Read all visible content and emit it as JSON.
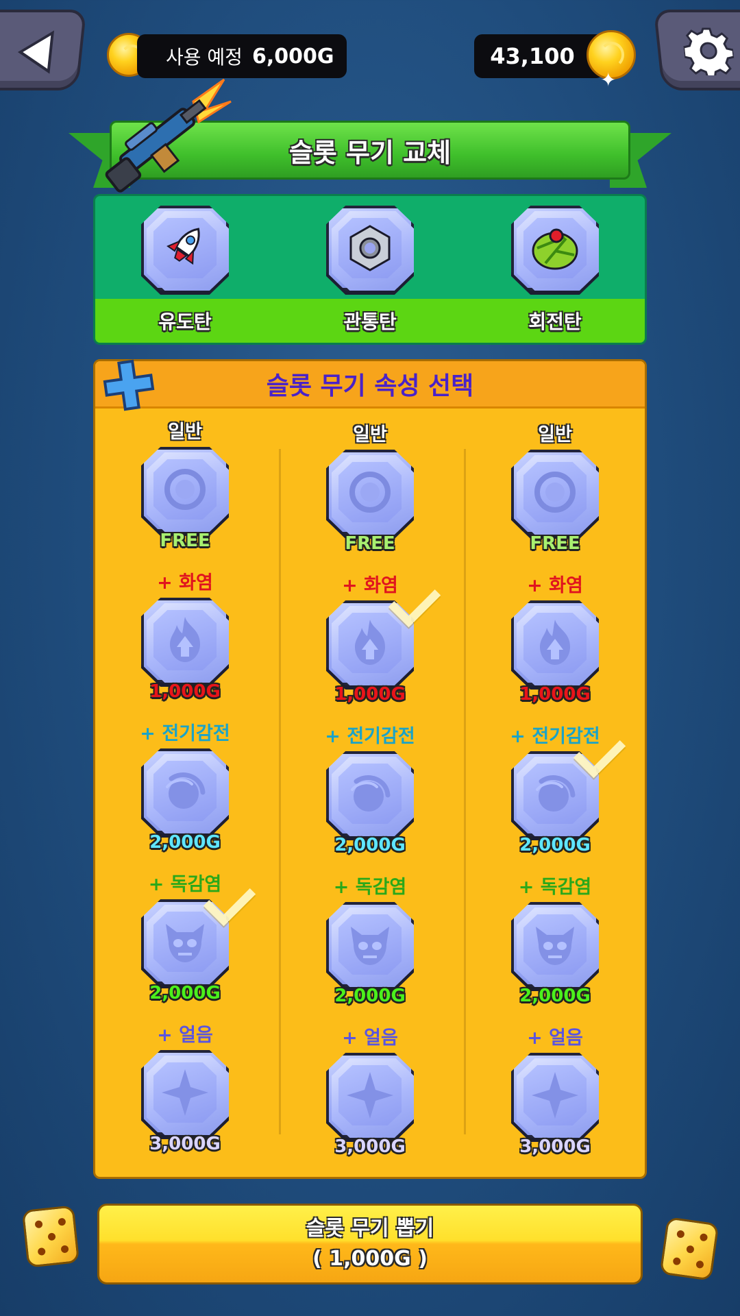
{
  "top_bar": {
    "pending_label": "사용 예정",
    "pending_amount": "6,000G",
    "gold_balance": "43,100",
    "back_icon": "back-arrow-icon",
    "settings_icon": "gear-icon"
  },
  "swap_section": {
    "title": "슬롯 무기 교체",
    "weapons": [
      {
        "label": "유도탄",
        "icon": "rocket-icon"
      },
      {
        "label": "관통탄",
        "icon": "hex-nut-icon"
      },
      {
        "label": "회전탄",
        "icon": "spinner-icon"
      }
    ]
  },
  "attribute_section": {
    "title": "슬롯 무기 속성 선택",
    "columns": [
      {
        "attributes": [
          {
            "label": "일반",
            "price": "FREE",
            "selected": false
          },
          {
            "label": "+ 화염",
            "price": "1,000G",
            "selected": false
          },
          {
            "label": "+ 전기감전",
            "price": "2,000G",
            "selected": false
          },
          {
            "label": "+ 독감염",
            "price": "2,000G",
            "selected": true
          },
          {
            "label": "+ 얼음",
            "price": "3,000G",
            "selected": false
          }
        ]
      },
      {
        "attributes": [
          {
            "label": "일반",
            "price": "FREE",
            "selected": false
          },
          {
            "label": "+ 화염",
            "price": "1,000G",
            "selected": true
          },
          {
            "label": "+ 전기감전",
            "price": "2,000G",
            "selected": false
          },
          {
            "label": "+ 독감염",
            "price": "2,000G",
            "selected": false
          },
          {
            "label": "+ 얼음",
            "price": "3,000G",
            "selected": false
          }
        ]
      },
      {
        "attributes": [
          {
            "label": "일반",
            "price": "FREE",
            "selected": false
          },
          {
            "label": "+ 화염",
            "price": "1,000G",
            "selected": false
          },
          {
            "label": "+ 전기감전",
            "price": "2,000G",
            "selected": true
          },
          {
            "label": "+ 독감염",
            "price": "2,000G",
            "selected": false
          },
          {
            "label": "+ 얼음",
            "price": "3,000G",
            "selected": false
          }
        ]
      }
    ]
  },
  "draw_button": {
    "label": "슬롯 무기 뽑기",
    "cost": "( 1,000G )"
  },
  "colors": {
    "normal_label": "#ffffff",
    "fire_label": "#e0141e",
    "electric_label": "#1aa3c8",
    "poison_label": "#2aa81a",
    "ice_label": "#5a55e0",
    "free_price": "#a8f070",
    "fire_price": "#e8141a",
    "electric_price": "#5fe6ff",
    "poison_price": "#4bf01c",
    "ice_price": "#d9d4ff"
  }
}
